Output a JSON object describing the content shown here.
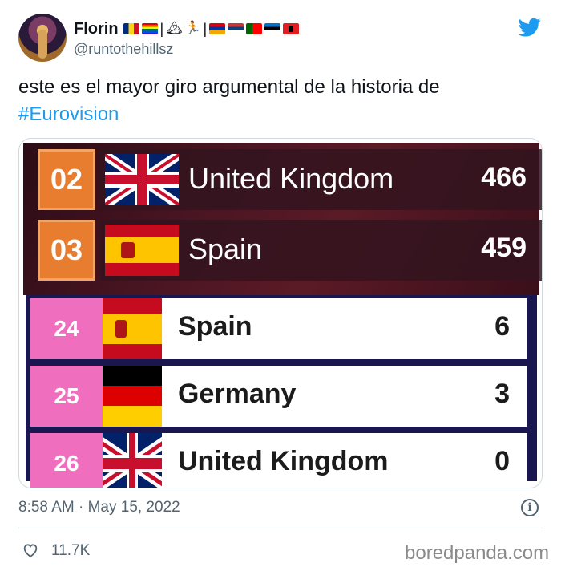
{
  "author": {
    "display_name": "Florin",
    "handle": "@runtothehillsz",
    "name_glyphs": [
      "🏔",
      "🏃"
    ]
  },
  "tweet": {
    "text_before": "este es el mayor giro argumental de la historia de ",
    "hashtag": "#Eurovision"
  },
  "media": {
    "top_board": [
      {
        "rank": "02",
        "country": "United Kingdom",
        "points": "466",
        "flag": "uk"
      },
      {
        "rank": "03",
        "country": "Spain",
        "points": "459",
        "flag": "es"
      }
    ],
    "bottom_board": [
      {
        "rank": "24",
        "country": "Spain",
        "points": "6",
        "flag": "es"
      },
      {
        "rank": "25",
        "country": "Germany",
        "points": "3",
        "flag": "de"
      },
      {
        "rank": "26",
        "country": "United Kingdom",
        "points": "0",
        "flag": "uk"
      }
    ]
  },
  "meta": {
    "timestamp": "8:58 AM · May 15, 2022",
    "likes": "11.7K"
  },
  "watermark": "boredpanda.com",
  "colors": {
    "twitter_blue": "#1d9bf0",
    "top_rank_orange": "#e87c2f",
    "bottom_rank_pink": "#ef6fbe"
  },
  "icons": [
    "twitter-bird-icon",
    "info-icon",
    "heart-icon"
  ]
}
